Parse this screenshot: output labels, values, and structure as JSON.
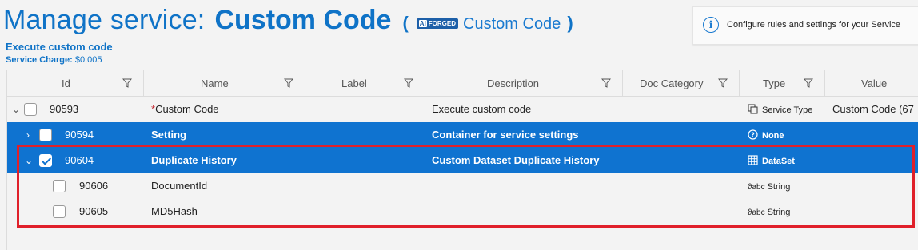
{
  "header": {
    "title_prefix": "Manage service:",
    "title_name": "Custom Code",
    "paren_open": "(",
    "paren_close": ")",
    "logo_badge": "AI",
    "logo_text": "FORGED",
    "breadcrumb": "Custom Code",
    "subtitle": "Execute custom code",
    "charge_label": "Service Charge:",
    "charge_value": "$0.005"
  },
  "info": {
    "text": "Configure rules and settings for your Service",
    "icon": "info-icon"
  },
  "columns": [
    {
      "label": "Id"
    },
    {
      "label": "Name"
    },
    {
      "label": "Label"
    },
    {
      "label": "Description"
    },
    {
      "label": "Doc Category"
    },
    {
      "label": "Type"
    },
    {
      "label": "Value"
    }
  ],
  "rows": [
    {
      "expander": "⌄",
      "checked": false,
      "id": "90593",
      "required_mark": "*",
      "name": "Custom Code",
      "description": "Execute custom code",
      "type_icon": "service-type-icon",
      "type": "Service Type",
      "value": "Custom Code (67"
    },
    {
      "expander": "›",
      "checked": false,
      "id": "90594",
      "name": "Setting",
      "description": "Container for service settings",
      "type_icon": "question-circle-icon",
      "type": "None",
      "value": "",
      "selected": true
    },
    {
      "expander": "⌄",
      "checked": true,
      "id": "90604",
      "name": "Duplicate History",
      "description": "Custom Dataset Duplicate History",
      "type_icon": "table-grid-icon",
      "type": "DataSet",
      "value": "",
      "selected": true
    },
    {
      "checked": false,
      "id": "90606",
      "name": "DocumentId",
      "description": "",
      "type_icon": "string-type-icon",
      "type": "String",
      "value": ""
    },
    {
      "checked": false,
      "id": "90605",
      "name": "MD5Hash",
      "description": "",
      "type_icon": "string-type-icon",
      "type": "String",
      "value": ""
    }
  ],
  "type_glyph_string": "ϑabc",
  "colors": {
    "accent": "#0f73c7",
    "selected_row": "#0f73d0",
    "highlight_frame": "#e0202a"
  }
}
